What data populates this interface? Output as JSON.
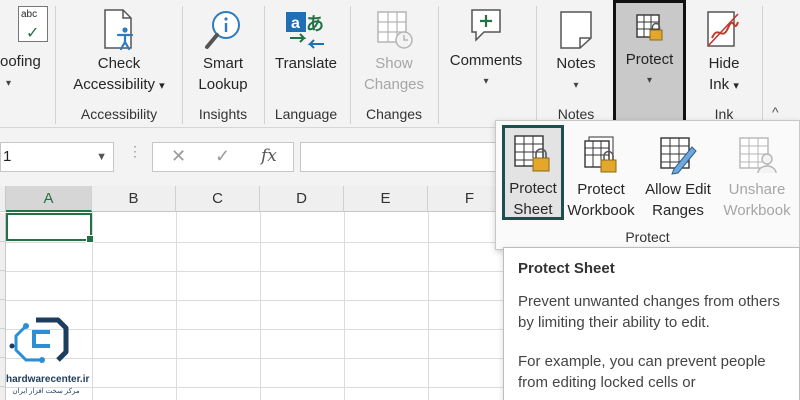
{
  "ribbon": {
    "proofing_label": "oofing",
    "spelling_icon_text": "abc",
    "check_accessibility": {
      "line1": "Check",
      "line2": "Accessibility",
      "chevron": "⌄"
    },
    "accessibility_group": "Accessibility",
    "smart_lookup": {
      "line1": "Smart",
      "line2": "Lookup"
    },
    "insights_group": "Insights",
    "translate": {
      "label": "Translate"
    },
    "language_group": "Language",
    "show_changes": {
      "line1": "Show",
      "line2": "Changes"
    },
    "changes_group": "Changes",
    "comments": {
      "label": "Comments"
    },
    "notes": {
      "label": "Notes"
    },
    "notes_group": "Notes",
    "protect": {
      "label": "Protect"
    },
    "hide_ink": {
      "line1": "Hide",
      "line2": "Ink"
    },
    "ink_group": "Ink",
    "collapse_icon": "^"
  },
  "formula_bar": {
    "name_box_value": "1",
    "cancel_symbol": "✕",
    "enter_symbol": "✓",
    "fx_symbol": "fx"
  },
  "grid": {
    "columns": [
      "A",
      "B",
      "C",
      "D",
      "E",
      "F"
    ],
    "selected_column": "A"
  },
  "protect_panel": {
    "group_label": "Protect",
    "items": [
      {
        "line1": "Protect",
        "line2": "Sheet"
      },
      {
        "line1": "Protect",
        "line2": "Workbook"
      },
      {
        "line1": "Allow Edit",
        "line2": "Ranges"
      },
      {
        "line1": "Unshare",
        "line2": "Workbook"
      }
    ]
  },
  "tooltip": {
    "title": "Protect Sheet",
    "body1": "Prevent unwanted changes from others by limiting their ability to edit.",
    "body2": "For example, you can prevent people from editing locked cells or"
  },
  "watermark": {
    "line1": "hardwarecenter.ir",
    "line2": "مرکز سخت افزار ایران"
  },
  "colors": {
    "excel_green": "#217346",
    "highlight_border": "#1d4f4f",
    "lock_gold": "#e3a82b"
  }
}
